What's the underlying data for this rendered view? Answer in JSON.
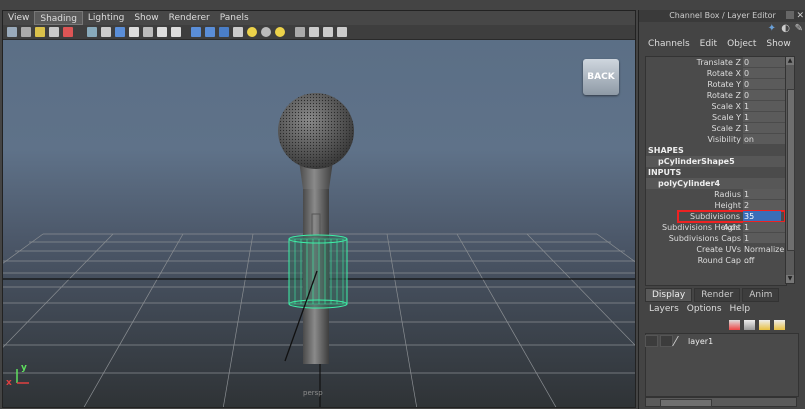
{
  "viewport": {
    "menu": [
      "View",
      "Shading",
      "Lighting",
      "Show",
      "Renderer",
      "Panels"
    ],
    "active_menu": "Shading",
    "back_label": "BACK",
    "camera_label": "persp",
    "axis_y": "y",
    "axis_x": "x"
  },
  "channel_box": {
    "title": "Channel Box / Layer Editor",
    "menu": [
      "Channels",
      "Edit",
      "Object",
      "Show"
    ],
    "transform_rows": [
      {
        "label": "Translate Z",
        "value": "0"
      },
      {
        "label": "Rotate X",
        "value": "0"
      },
      {
        "label": "Rotate Y",
        "value": "0"
      },
      {
        "label": "Rotate Z",
        "value": "0"
      },
      {
        "label": "Scale X",
        "value": "1"
      },
      {
        "label": "Scale Y",
        "value": "1"
      },
      {
        "label": "Scale Z",
        "value": "1"
      },
      {
        "label": "Visibility",
        "value": "on"
      }
    ],
    "shapes_header": "SHAPES",
    "shape_node": "pCylinderShape5",
    "inputs_header": "INPUTS",
    "input_node": "polyCylinder4",
    "input_rows": [
      {
        "label": "Radius",
        "value": "1"
      },
      {
        "label": "Height",
        "value": "2"
      },
      {
        "label": "Subdivisions Axis",
        "value": "35"
      },
      {
        "label": "Subdivisions Height",
        "value": "1"
      },
      {
        "label": "Subdivisions Caps",
        "value": "1"
      },
      {
        "label": "Create UVs",
        "value": "Normalize ..."
      },
      {
        "label": "Round Cap",
        "value": "off"
      }
    ]
  },
  "layer_editor": {
    "tabs": [
      "Display",
      "Render",
      "Anim"
    ],
    "active_tab": "Display",
    "menu": [
      "Layers",
      "Options",
      "Help"
    ],
    "layers": [
      {
        "name": "layer1"
      }
    ]
  }
}
